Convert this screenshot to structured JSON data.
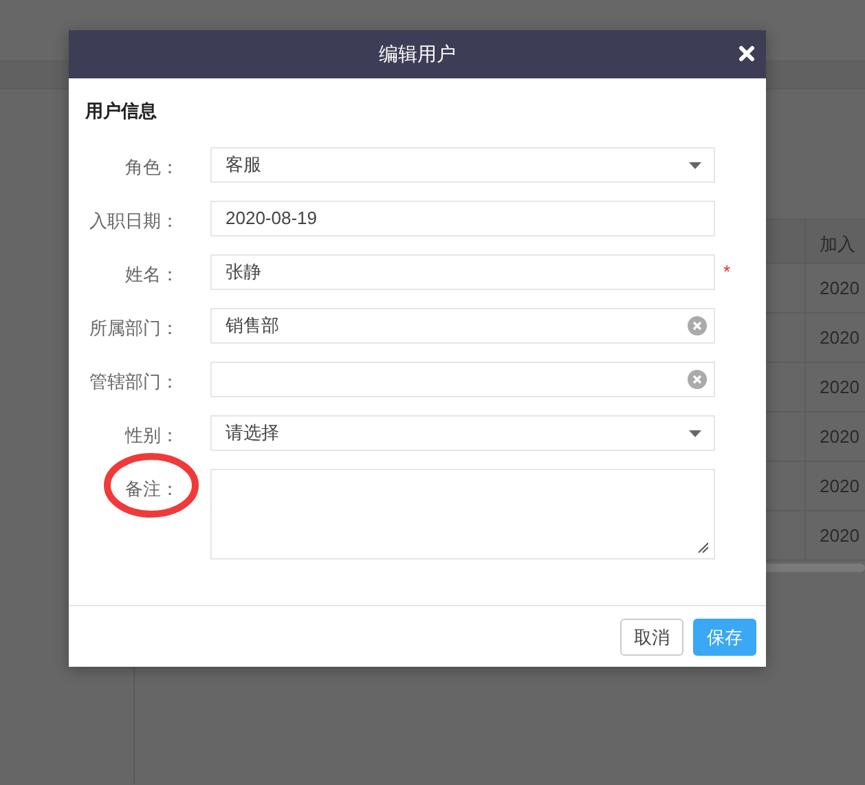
{
  "background": {
    "table": {
      "column_header": "加入",
      "cells": [
        "2020",
        "2020",
        "2020",
        "2020",
        "2020",
        "2020"
      ]
    }
  },
  "dialog": {
    "title": "编辑用户",
    "section": "用户信息",
    "fields": [
      {
        "kind": "select",
        "label": "角色：",
        "value": "客服"
      },
      {
        "kind": "text",
        "label": "入职日期：",
        "value": "2020-08-19"
      },
      {
        "kind": "text",
        "label": "姓名：",
        "value": "张静",
        "required_mark": "*"
      },
      {
        "kind": "clearable",
        "label": "所属部门：",
        "value": "销售部"
      },
      {
        "kind": "clearable",
        "label": "管辖部门："
      },
      {
        "kind": "select",
        "label": "性别：",
        "value": "请选择"
      },
      {
        "kind": "textarea",
        "label": "备注：",
        "highlighted": true
      }
    ],
    "buttons": [
      {
        "label": "取消",
        "kind": "default"
      },
      {
        "label": "保存",
        "kind": "primary"
      }
    ]
  }
}
